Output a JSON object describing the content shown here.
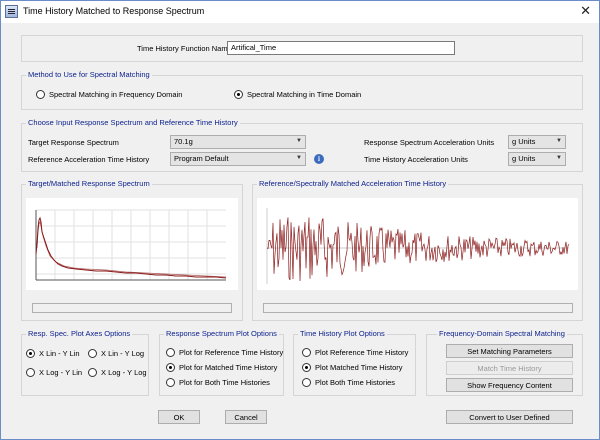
{
  "window": {
    "title": "Time History Matched to Response Spectrum",
    "close_glyph": "✕"
  },
  "function_name": {
    "label": "Time History Function Name",
    "value": "Artifical_Time"
  },
  "method": {
    "legend": "Method to Use for Spectral Matching",
    "options": [
      {
        "label": "Spectral Matching in Frequency Domain",
        "selected": false
      },
      {
        "label": "Spectral Matching in Time Domain",
        "selected": true
      }
    ]
  },
  "inputs": {
    "legend": "Choose Input Response Spectrum and Reference Time History",
    "target_rs_label": "Target Response Spectrum",
    "target_rs_value": "70.1g",
    "ref_th_label": "Reference Acceleration Time History",
    "ref_th_value": "Program Default",
    "rs_units_label": "Response Spectrum Acceleration Units",
    "rs_units_value": "g Units",
    "th_units_label": "Time History Acceleration Units",
    "th_units_value": "g Units",
    "info_glyph": "i"
  },
  "spectrum_plot": {
    "legend": "Target/Matched Response Spectrum"
  },
  "history_plot": {
    "legend": "Reference/Spectrally Matched Acceleration Time History"
  },
  "axes_options": {
    "legend": "Resp. Spec. Plot Axes Options",
    "options": [
      {
        "label": "X Lin - Y Lin",
        "selected": true
      },
      {
        "label": "X Lin - Y Log",
        "selected": false
      },
      {
        "label": "X Log - Y Lin",
        "selected": false
      },
      {
        "label": "X Log - Y Log",
        "selected": false
      }
    ]
  },
  "rs_plot_options": {
    "legend": "Response Spectrum Plot Options",
    "options": [
      {
        "label": "Plot for Reference Time History",
        "selected": false
      },
      {
        "label": "Plot for Matched Time History",
        "selected": true
      },
      {
        "label": "Plot for Both Time Histories",
        "selected": false
      }
    ]
  },
  "th_plot_options": {
    "legend": "Time History Plot Options",
    "options": [
      {
        "label": "Plot Reference Time History",
        "selected": false
      },
      {
        "label": "Plot Matched Time History",
        "selected": true
      },
      {
        "label": "Plot Both Time Histories",
        "selected": false
      }
    ]
  },
  "freq_matching": {
    "legend": "Frequency-Domain Spectral Matching",
    "set_params": "Set Matching Parameters",
    "match_th": "Match Time History",
    "show_freq": "Show Frequency Content"
  },
  "buttons": {
    "ok": "OK",
    "cancel": "Cancel",
    "convert": "Convert to User Defined"
  },
  "colors": {
    "curve": "#8b1a1a",
    "legend_text": "#0a1e8c",
    "accent": "#3d6cbf"
  }
}
